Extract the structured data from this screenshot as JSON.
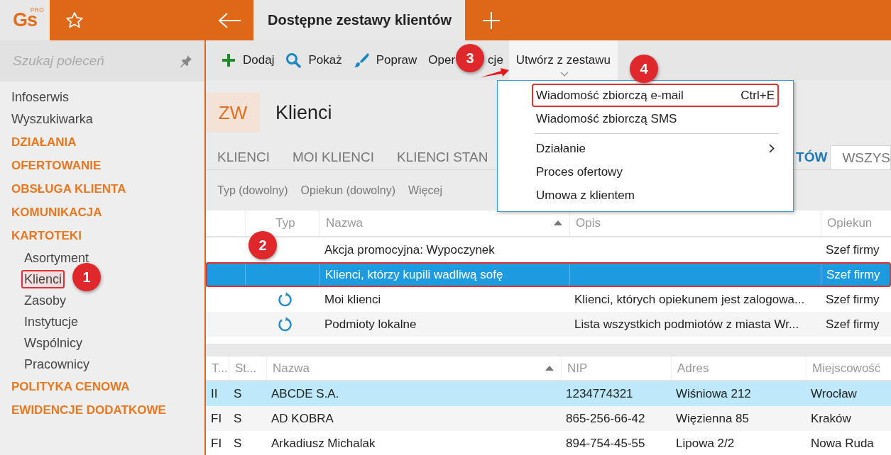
{
  "app": {
    "logo": "Gs",
    "logo_badge": "PRO"
  },
  "window_tab": {
    "title": "Dostępne zestawy klientów",
    "selected": true
  },
  "sidebar": {
    "search": {
      "placeholder": "Szukaj poleceń"
    },
    "items": [
      {
        "label": "Infoserwis",
        "kind": "link"
      },
      {
        "label": "Wyszukiwarka",
        "kind": "link"
      },
      {
        "label": "DZIAŁANIA",
        "kind": "category"
      },
      {
        "label": "OFERTOWANIE",
        "kind": "category"
      },
      {
        "label": "OBSŁUGA KLIENTA",
        "kind": "category"
      },
      {
        "label": "KOMUNIKACJA",
        "kind": "category"
      },
      {
        "label": "KARTOTEKI",
        "kind": "category",
        "children": [
          {
            "label": "Asortyment",
            "selected": false,
            "outlined": false
          },
          {
            "label": "Klienci",
            "selected": true,
            "outlined": true
          },
          {
            "label": "Zasoby",
            "selected": false,
            "outlined": false
          },
          {
            "label": "Instytucje",
            "selected": false,
            "outlined": false
          },
          {
            "label": "Wspólnicy",
            "selected": false,
            "outlined": false
          },
          {
            "label": "Pracownicy",
            "selected": false,
            "outlined": false
          }
        ]
      },
      {
        "label": "POLITYKA CENOWA",
        "kind": "category"
      },
      {
        "label": "EWIDENCJE DODATKOWE",
        "kind": "category"
      }
    ]
  },
  "toolbar": [
    {
      "label": "Dodaj",
      "kind": "add",
      "open": false
    },
    {
      "label": "Pokaż",
      "kind": "show",
      "open": false
    },
    {
      "label": "Popraw",
      "kind": "edit",
      "open": false
    },
    {
      "label": "Oper",
      "label_after": "cje",
      "kind": "plain",
      "open": false
    },
    {
      "label": "Utwórz z zestawu",
      "kind": "menu",
      "open": true
    }
  ],
  "menu": {
    "items": [
      {
        "label": "Wiadomość zbiorczą e-mail",
        "shortcut": "Ctrl+E",
        "kind": "item",
        "outlined": true
      },
      {
        "label": "Wiadomość zbiorczą SMS",
        "kind": "item",
        "outlined": false
      },
      {
        "kind": "separator"
      },
      {
        "label": "Działanie",
        "kind": "submenu",
        "outlined": false
      },
      {
        "label": "Proces ofertowy",
        "kind": "item",
        "outlined": false
      },
      {
        "label": "Umowa z klientem",
        "kind": "item",
        "outlined": false
      }
    ]
  },
  "header": {
    "badge": "ZW",
    "title": "Klienci"
  },
  "tabs": [
    {
      "label": "KLIENCI",
      "selected": false
    },
    {
      "label": "MOI KLIENCI",
      "selected": false
    },
    {
      "label": "KLIENCI STAN",
      "selected": false
    },
    {
      "label": "TÓW",
      "selected": true
    },
    {
      "label": "WSZYS",
      "selected": false
    }
  ],
  "filters": [
    "Typ (dowolny)",
    "Opiekun (dowolny)",
    "Więcej"
  ],
  "sets_table": {
    "columns": [
      {
        "label": "Typ",
        "sorted": false
      },
      {
        "label": "Nazwa",
        "sorted": true
      },
      {
        "label": "Opis",
        "sorted": false
      },
      {
        "label": "Opiekun",
        "sorted": false
      }
    ],
    "rows": [
      {
        "kind": "static",
        "name": "Akcja promocyjna: Wypoczynek",
        "description": "",
        "owner": "Szef firmy",
        "selected": false,
        "outlined": false
      },
      {
        "kind": "static",
        "name": "Klienci, którzy kupili wadliwą sofę",
        "description": "",
        "owner": "Szef firmy",
        "selected": true,
        "outlined": true
      },
      {
        "kind": "dynamic",
        "name": "Moi klienci",
        "description": "Klienci, których opiekunem jest zalogowa...",
        "owner": "Szef firmy",
        "selected": false,
        "outlined": false
      },
      {
        "kind": "dynamic",
        "name": "Podmioty lokalne",
        "description": "Lista wszystkich podmiotów z miasta Wr...",
        "owner": "Szef firmy",
        "selected": false,
        "outlined": false
      }
    ]
  },
  "clients_table": {
    "columns": [
      {
        "label": "T...",
        "sorted": false
      },
      {
        "label": "St...",
        "sorted": false
      },
      {
        "label": "Nazwa",
        "sorted": true
      },
      {
        "label": "NIP",
        "sorted": false
      },
      {
        "label": "Adres",
        "sorted": false
      },
      {
        "label": "Miejscowość",
        "sorted": false
      }
    ],
    "rows": [
      {
        "cells": [
          "II",
          "S",
          "ABCDE S.A.",
          "1234774321",
          "Wiśniowa 212",
          "Wrocław"
        ],
        "selected": true
      },
      {
        "cells": [
          "FI",
          "S",
          "AD KOBRA",
          "865-256-66-42",
          "Więzienna  85",
          "Kraków"
        ],
        "selected": false
      },
      {
        "cells": [
          "FI",
          "S",
          "Arkadiusz Michalak",
          "894-754-45-55",
          "Lipowa  2/2",
          "Nowa Ruda"
        ],
        "selected": false
      }
    ]
  },
  "callouts": [
    {
      "number": "1",
      "arrow": false
    },
    {
      "number": "2",
      "arrow": false
    },
    {
      "number": "3",
      "arrow": true
    },
    {
      "number": "4",
      "arrow": false
    }
  ]
}
